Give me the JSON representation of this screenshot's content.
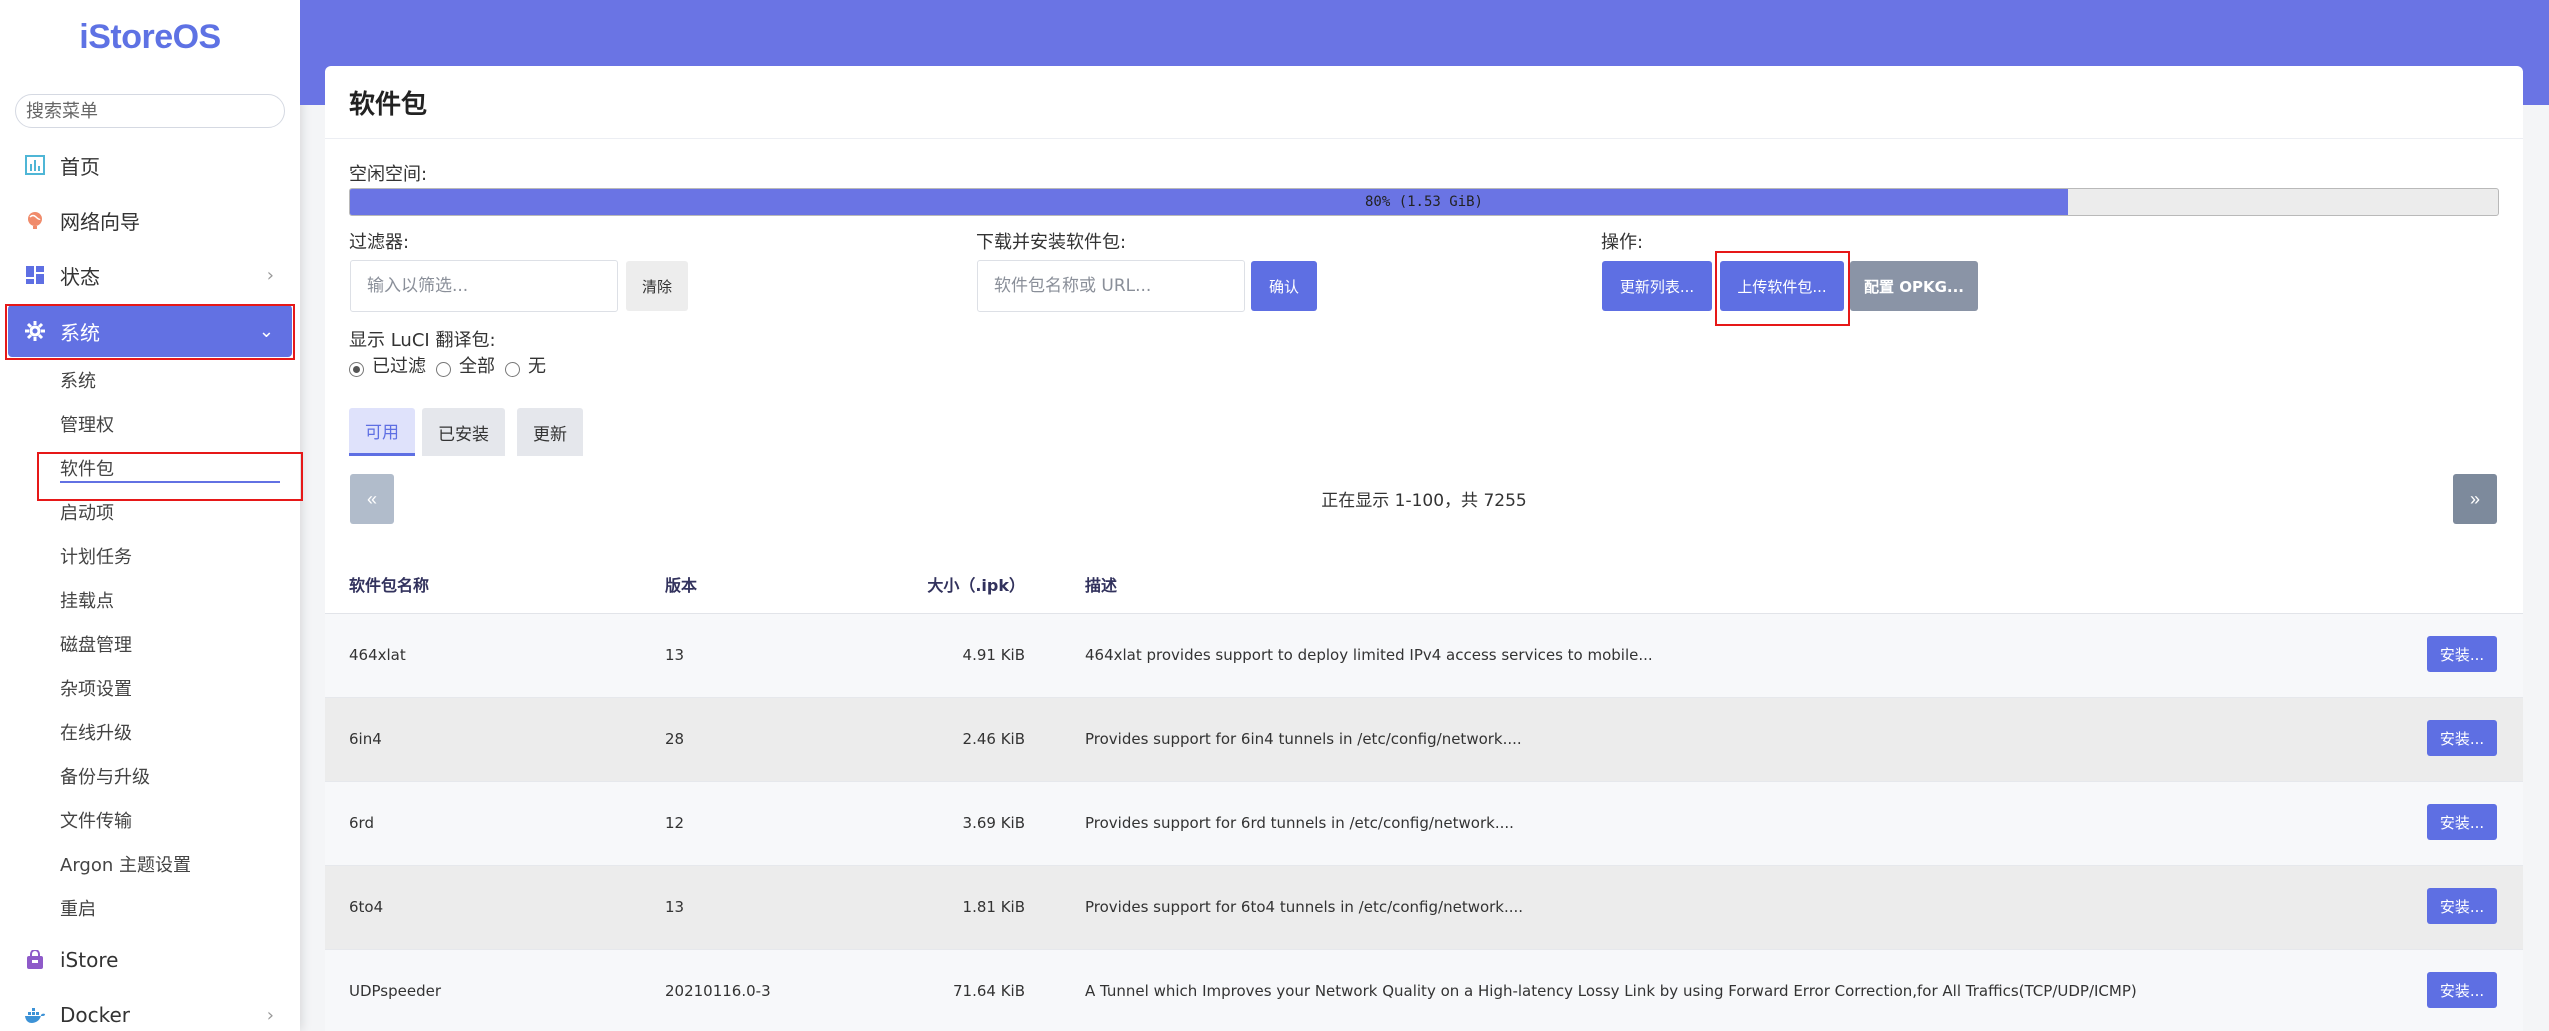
{
  "sidebar": {
    "logo": "iStoreOS",
    "search_placeholder": "搜索菜单",
    "menu": [
      {
        "label": "首页"
      },
      {
        "label": "网络向导"
      },
      {
        "label": "状态"
      },
      {
        "label": "系统"
      }
    ],
    "submenu": [
      "系统",
      "管理权",
      "软件包",
      "启动项",
      "计划任务",
      "挂载点",
      "磁盘管理",
      "杂项设置",
      "在线升级",
      "备份与升级",
      "文件传输",
      "Argon 主题设置",
      "重启"
    ],
    "bottom_menu": [
      {
        "label": "iStore"
      },
      {
        "label": "Docker"
      }
    ]
  },
  "page": {
    "title": "软件包",
    "free_space_label": "空闲空间:",
    "free_space_text": "80% (1.53 GiB)",
    "free_space_percent": 80,
    "filter_label": "过滤器:",
    "filter_placeholder": "输入以筛选...",
    "clear_button": "清除",
    "download_label": "下载并安装软件包:",
    "download_placeholder": "软件包名称或 URL...",
    "confirm_button": "确认",
    "actions_label": "操作:",
    "update_lists_button": "更新列表...",
    "upload_button": "上传软件包...",
    "configure_button": "配置 OPKG...",
    "luci_label": "显示 LuCI 翻译包:",
    "radio_options": [
      "已过滤",
      "全部",
      "无"
    ],
    "tabs": [
      "可用",
      "已安装",
      "更新"
    ],
    "prev_page": "«",
    "next_page": "»",
    "pager_text": "正在显示 1-100，共 7255"
  },
  "table": {
    "headers": {
      "name": "软件包名称",
      "version": "版本",
      "size": "大小（.ipk）",
      "desc": "描述"
    },
    "install_label": "安装...",
    "rows": [
      {
        "name": "464xlat",
        "version": "13",
        "size": "4.91 KiB",
        "desc": "464xlat provides support to deploy limited IPv4 access services to mobile..."
      },
      {
        "name": "6in4",
        "version": "28",
        "size": "2.46 KiB",
        "desc": "Provides support for 6in4 tunnels in /etc/config/network...."
      },
      {
        "name": "6rd",
        "version": "12",
        "size": "3.69 KiB",
        "desc": "Provides support for 6rd tunnels in /etc/config/network...."
      },
      {
        "name": "6to4",
        "version": "13",
        "size": "1.81 KiB",
        "desc": "Provides support for 6to4 tunnels in /etc/config/network...."
      },
      {
        "name": "UDPspeeder",
        "version": "20210116.0-3",
        "size": "71.64 KiB",
        "desc": "A Tunnel which Improves your Network Quality on a High-latency Lossy Link by using Forward Error Correction,for All Traffics(TCP/UDP/ICMP)"
      }
    ]
  },
  "colors": {
    "accent": "#5e6fe3",
    "topbar": "#6a74e4",
    "highlight": "#e61818"
  }
}
